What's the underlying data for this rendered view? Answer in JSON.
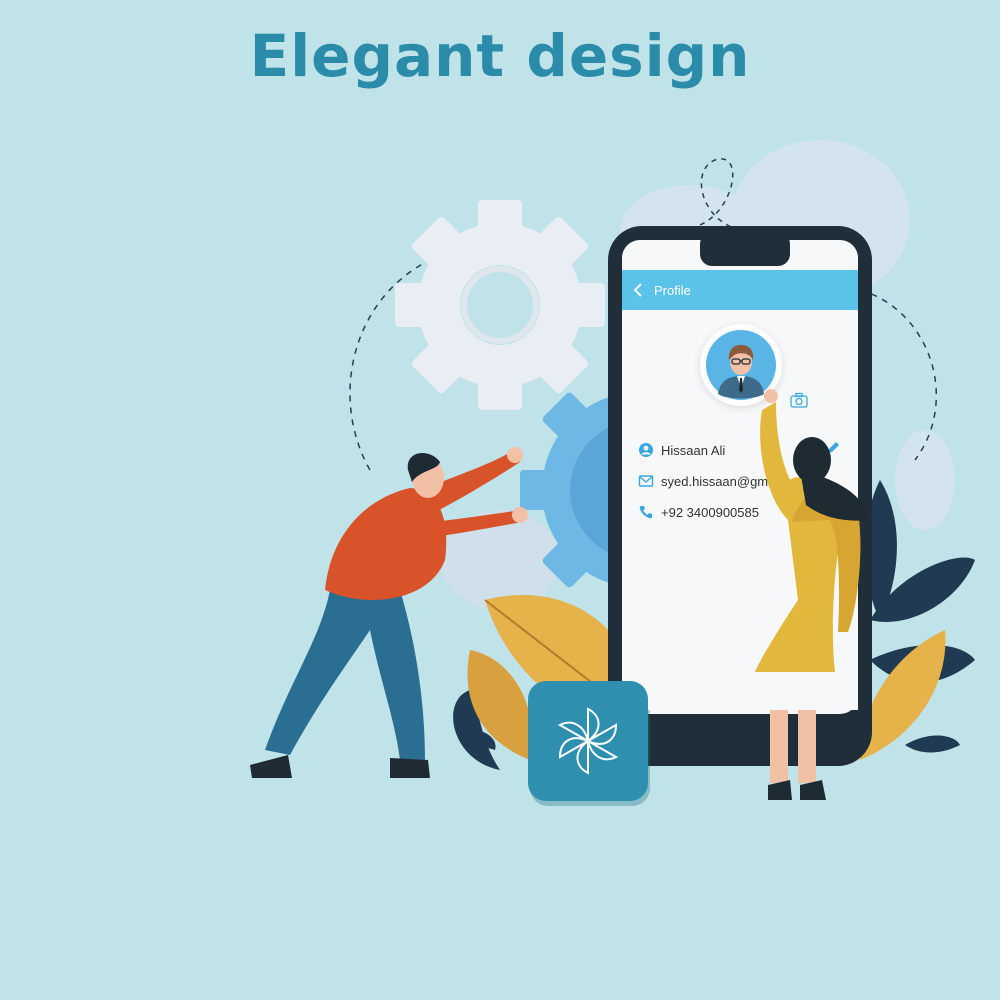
{
  "headline": "Elegant design",
  "colors": {
    "background": "#bfe3e9",
    "headline": "#2a8ca8",
    "appbar": "#5bc2ea",
    "icon_blue": "#3aa8e0",
    "phone_frame": "#1f2e38",
    "logo_tile": "#2e8fae"
  },
  "profile_screen": {
    "back_icon": "chevron-left-icon",
    "title": "Profile",
    "avatar_icon": "businessman-avatar",
    "camera_icon": "camera-icon",
    "edit_icon": "pencil-icon",
    "fields": [
      {
        "icon": "person-icon",
        "value": "Hissaan Ali"
      },
      {
        "icon": "envelope-icon",
        "value": "syed.hissaan@gmail.com"
      },
      {
        "icon": "phone-icon",
        "value": "+92 3400900585"
      }
    ]
  },
  "logo": {
    "icon": "pinwheel-logo"
  }
}
